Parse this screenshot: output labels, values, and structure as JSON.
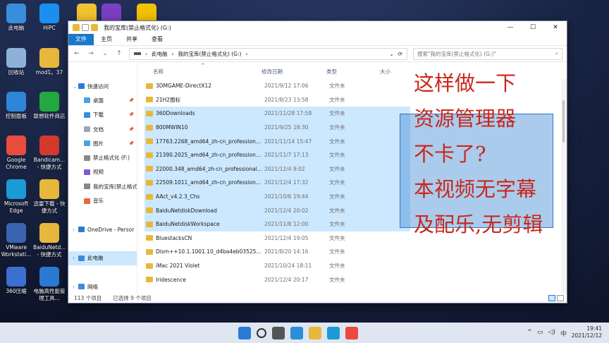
{
  "desktop": {
    "icons": [
      {
        "label": "此电脑",
        "color": "#3a8ddb"
      },
      {
        "label": "HiPC",
        "color": "#1b8ff0"
      },
      {
        "label": "",
        "color": "#f1c232"
      },
      {
        "label": "",
        "color": "#7b3fc4"
      },
      {
        "label": "",
        "color": "#f2c200"
      },
      {
        "label": "回收站",
        "color": "#8fb0d8"
      },
      {
        "label": "mod1。37",
        "color": "#e8b83c"
      },
      {
        "label": "控制面板",
        "color": "#2f86d8"
      },
      {
        "label": "联想软件商店",
        "color": "#23a93f"
      },
      {
        "label": "Google Chrome",
        "color": "#e84c3d"
      },
      {
        "label": "Bandicam... - 快捷方式",
        "color": "#d33a2c"
      },
      {
        "label": "Microsoft Edge",
        "color": "#1b9ad6"
      },
      {
        "label": "迅雷下载 - 快捷方式",
        "color": "#e8b83c"
      },
      {
        "label": "VMware Workstati...",
        "color": "#3a63b0"
      },
      {
        "label": "BaiduNetd... - 快捷方式",
        "color": "#e8b83c"
      },
      {
        "label": "360压缩",
        "color": "#3b6fd1"
      },
      {
        "label": "电脑高性能管理工具...",
        "color": "#2b79d3"
      }
    ]
  },
  "window": {
    "title": "我的宝库(禁止格式化) (G:)",
    "controls": {
      "minimize": "—",
      "maximize": "☐",
      "close": "✕"
    },
    "ribbon": [
      "文件",
      "主页",
      "共享",
      "查看"
    ],
    "address": {
      "segments": [
        "此电脑",
        "我的宝库(禁止格式化) (G:)"
      ],
      "sep": "›"
    },
    "search_placeholder": "搜索\"我的宝库(禁止格式化) (G:)\"",
    "nav": [
      {
        "label": "快速访问",
        "color": "#2a7bd6",
        "pin": ""
      },
      {
        "label": "桌面",
        "color": "#4aa3e8",
        "pin": "📌"
      },
      {
        "label": "下载",
        "color": "#3a8ddb",
        "pin": "📌"
      },
      {
        "label": "文档",
        "color": "#9aa6b5",
        "pin": "📌"
      },
      {
        "label": "图片",
        "color": "#4aa3e8",
        "pin": "📌"
      },
      {
        "label": "禁止格式化 (F:)",
        "color": "#888888",
        "pin": ""
      },
      {
        "label": "视频",
        "color": "#7d5bd6",
        "pin": ""
      },
      {
        "label": "我的宝库(禁止格式化)",
        "color": "#888888",
        "pin": ""
      },
      {
        "label": "音乐",
        "color": "#e06b3c",
        "pin": ""
      },
      {
        "label": "",
        "color": "transparent",
        "pin": ""
      },
      {
        "label": "OneDrive - Persor",
        "color": "#2a7bd6",
        "pin": ""
      },
      {
        "label": "",
        "color": "transparent",
        "pin": ""
      },
      {
        "label": "此电脑",
        "color": "#3a8ddb",
        "pin": ""
      },
      {
        "label": "",
        "color": "transparent",
        "pin": ""
      },
      {
        "label": "网络",
        "color": "#3a8ddb",
        "pin": ""
      }
    ],
    "columns": [
      "名称",
      "修改日期",
      "类型",
      "大小"
    ],
    "files": [
      {
        "name": "3DMGAME-DirectX12",
        "date": "2021/9/12 17:06",
        "type": "文件夹",
        "sel": false
      },
      {
        "name": "21H2图标",
        "date": "2021/8/23 13:58",
        "type": "文件夹",
        "sel": false
      },
      {
        "name": "360Downloads",
        "date": "2021/11/28 17:58",
        "type": "文件夹",
        "sel": true
      },
      {
        "name": "800MWIN10",
        "date": "2021/9/25 18:30",
        "type": "文件夹",
        "sel": true
      },
      {
        "name": "17763.2268_amd64_zh-cn_profession...",
        "date": "2021/11/14 15:47",
        "type": "文件夹",
        "sel": true
      },
      {
        "name": "21390.2025_amd64_zh-cn_profession...",
        "date": "2021/11/7 17:13",
        "type": "文件夹",
        "sel": true
      },
      {
        "name": "22000.348_amd64_zh-cn_professional...",
        "date": "2021/12/4 9:02",
        "type": "文件夹",
        "sel": true
      },
      {
        "name": "22509.1011_amd64_zh-cn_profession...",
        "date": "2021/12/4 17:32",
        "type": "文件夹",
        "sel": true
      },
      {
        "name": "AAct_v4.2.3_Chs",
        "date": "2021/10/6 19:44",
        "type": "文件夹",
        "sel": true
      },
      {
        "name": "BaiduNetdiskDownload",
        "date": "2021/12/4 20:02",
        "type": "文件夹",
        "sel": true
      },
      {
        "name": "BaiduNetdiskWorkspace",
        "date": "2021/11/8 12:00",
        "type": "文件夹",
        "sel": true
      },
      {
        "name": "BluestacksCN",
        "date": "2021/12/4 19:05",
        "type": "文件夹",
        "sel": false
      },
      {
        "name": "Dism++10.1.1001.10_d4ba4eb03525...",
        "date": "2021/8/20 14:16",
        "type": "文件夹",
        "sel": false
      },
      {
        "name": "iMac 2021 Violet",
        "date": "2021/10/24 18:11",
        "type": "文件夹",
        "sel": false
      },
      {
        "name": "Iridescence",
        "date": "2021/12/4 20:17",
        "type": "文件夹",
        "sel": false
      }
    ],
    "status": {
      "count": "113 个项目",
      "selected": "已选择 9 个项目"
    }
  },
  "overlay_text": [
    "这样做一下",
    "资源管理器",
    "不卡了?",
    "本视频无字幕",
    "及配乐,无剪辑"
  ],
  "taskbar": {
    "apps": [
      {
        "name": "start",
        "color": "#2a7bd6"
      },
      {
        "name": "search",
        "color": "#dfe6f2"
      },
      {
        "name": "task-view",
        "color": "#555"
      },
      {
        "name": "widgets",
        "color": "#2a8fd8"
      },
      {
        "name": "explorer",
        "color": "#e8b83c"
      },
      {
        "name": "edge",
        "color": "#1b9ad6"
      },
      {
        "name": "chrome",
        "color": "#e84c3d"
      }
    ],
    "time": "19:41",
    "date": "2021/12/12"
  }
}
